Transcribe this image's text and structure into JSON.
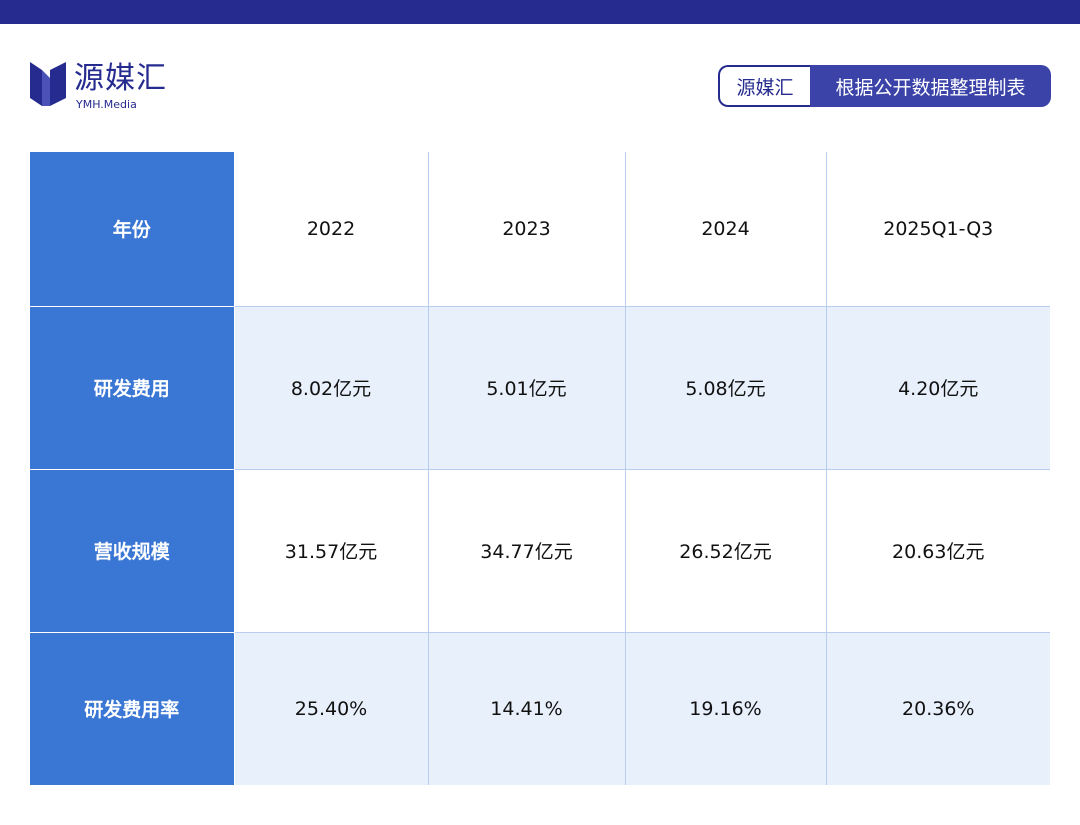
{
  "brand": {
    "name_cn": "源媒汇",
    "name_en": "YMH.Media",
    "color": "#262b8f"
  },
  "source_badge": {
    "brand": "源媒汇",
    "text": "根据公开数据整理制表"
  },
  "chart_data": {
    "type": "table",
    "header_color": "#3a76d3",
    "row_tint_color": "#e8f0fb",
    "rows": [
      {
        "label": "年份",
        "values": [
          "2022",
          "2023",
          "2024",
          "2025Q1-Q3"
        ]
      },
      {
        "label": "研发费用",
        "values": [
          "8.02亿元",
          "5.01亿元",
          "5.08亿元",
          "4.20亿元"
        ]
      },
      {
        "label": "营收规模",
        "values": [
          "31.57亿元",
          "34.77亿元",
          "26.52亿元",
          "20.63亿元"
        ]
      },
      {
        "label": "研发费用率",
        "values": [
          "25.40%",
          "14.41%",
          "19.16%",
          "20.36%"
        ]
      }
    ]
  }
}
